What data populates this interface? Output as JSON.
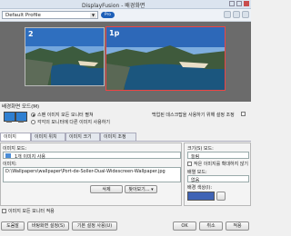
{
  "window": {
    "title": "DisplayFusion - 배경화면"
  },
  "toolbar": {
    "profile": "Default Profile",
    "pro_badge": "Pro"
  },
  "preview": {
    "monitors": [
      {
        "number": "2"
      },
      {
        "number": "1p"
      }
    ]
  },
  "mode": {
    "label": "배경화면 모드(M)",
    "options": [
      "스팬 이미지 모든 모니터 펼쳐",
      "각각의 모니터에 다른 이미지 사용하기"
    ],
    "right_text": "백업된 데스크탑을 사용하기 위해 설정 조정"
  },
  "tabs": [
    "이미지",
    "이미지 위치",
    "이미지 크기",
    "이미지 조정"
  ],
  "left_panel": {
    "source_label": "이미지 모드:",
    "source_value": "1개 이미지 사용",
    "path_label": "이미지:",
    "path_value": "D:\\Wallpapers\\wallpaper\\Port-de-Soller-Dual-Widescreen-Wallpaper.jpg",
    "btn_delete": "삭제",
    "btn_browse": "찾아보기..."
  },
  "right_panel": {
    "size_label": "크기(S) 모드:",
    "size_value": "늘림",
    "checkbox_label": "작은 이미지를 확대하지 않기",
    "tile_label": "배열 모드:",
    "tile_value": "없음",
    "color_label": "배경 색상(I):"
  },
  "footer": {
    "apply_all_check": "이미지 모든 모니터 적용",
    "buttons": [
      "도움말",
      "바탕화면 설정(S)",
      "기본 설정 사용(U)",
      "OK",
      "취소",
      "적용"
    ]
  },
  "colors": {
    "accent": "#1d5fb8",
    "selection": "#e44444",
    "color_swatch": "#3f63b5"
  }
}
